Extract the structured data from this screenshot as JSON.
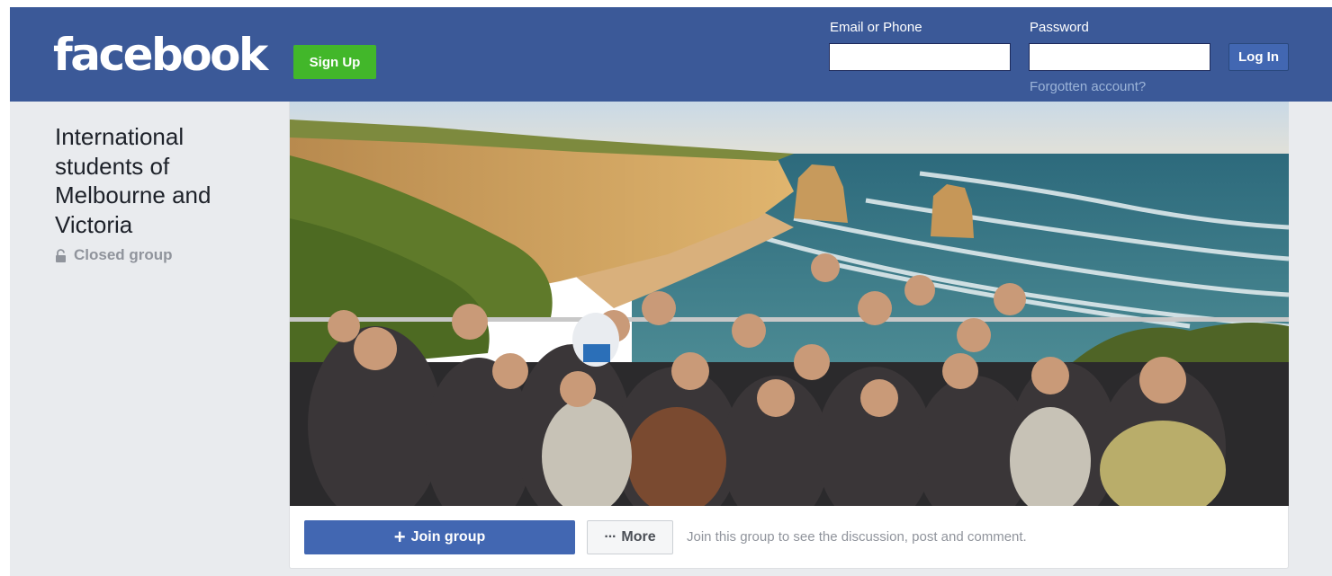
{
  "header": {
    "logo_text": "facebook",
    "signup_label": "Sign Up",
    "email_label": "Email or Phone",
    "email_value": "",
    "password_label": "Password",
    "password_value": "",
    "login_label": "Log In",
    "forgot_label": "Forgotten account?"
  },
  "group": {
    "name": "International students of Melbourne and Victoria",
    "privacy_icon": "lock-icon",
    "privacy_label": "Closed group"
  },
  "actions": {
    "join_icon": "plus-icon",
    "join_label": "Join group",
    "more_icon": "dots-icon",
    "more_label": "More",
    "hint": "Join this group to see the discussion, post and comment."
  },
  "colors": {
    "brand_blue": "#3b5998",
    "button_blue": "#4267b2",
    "signup_green": "#42b72a",
    "page_bg": "#e9ebee"
  }
}
